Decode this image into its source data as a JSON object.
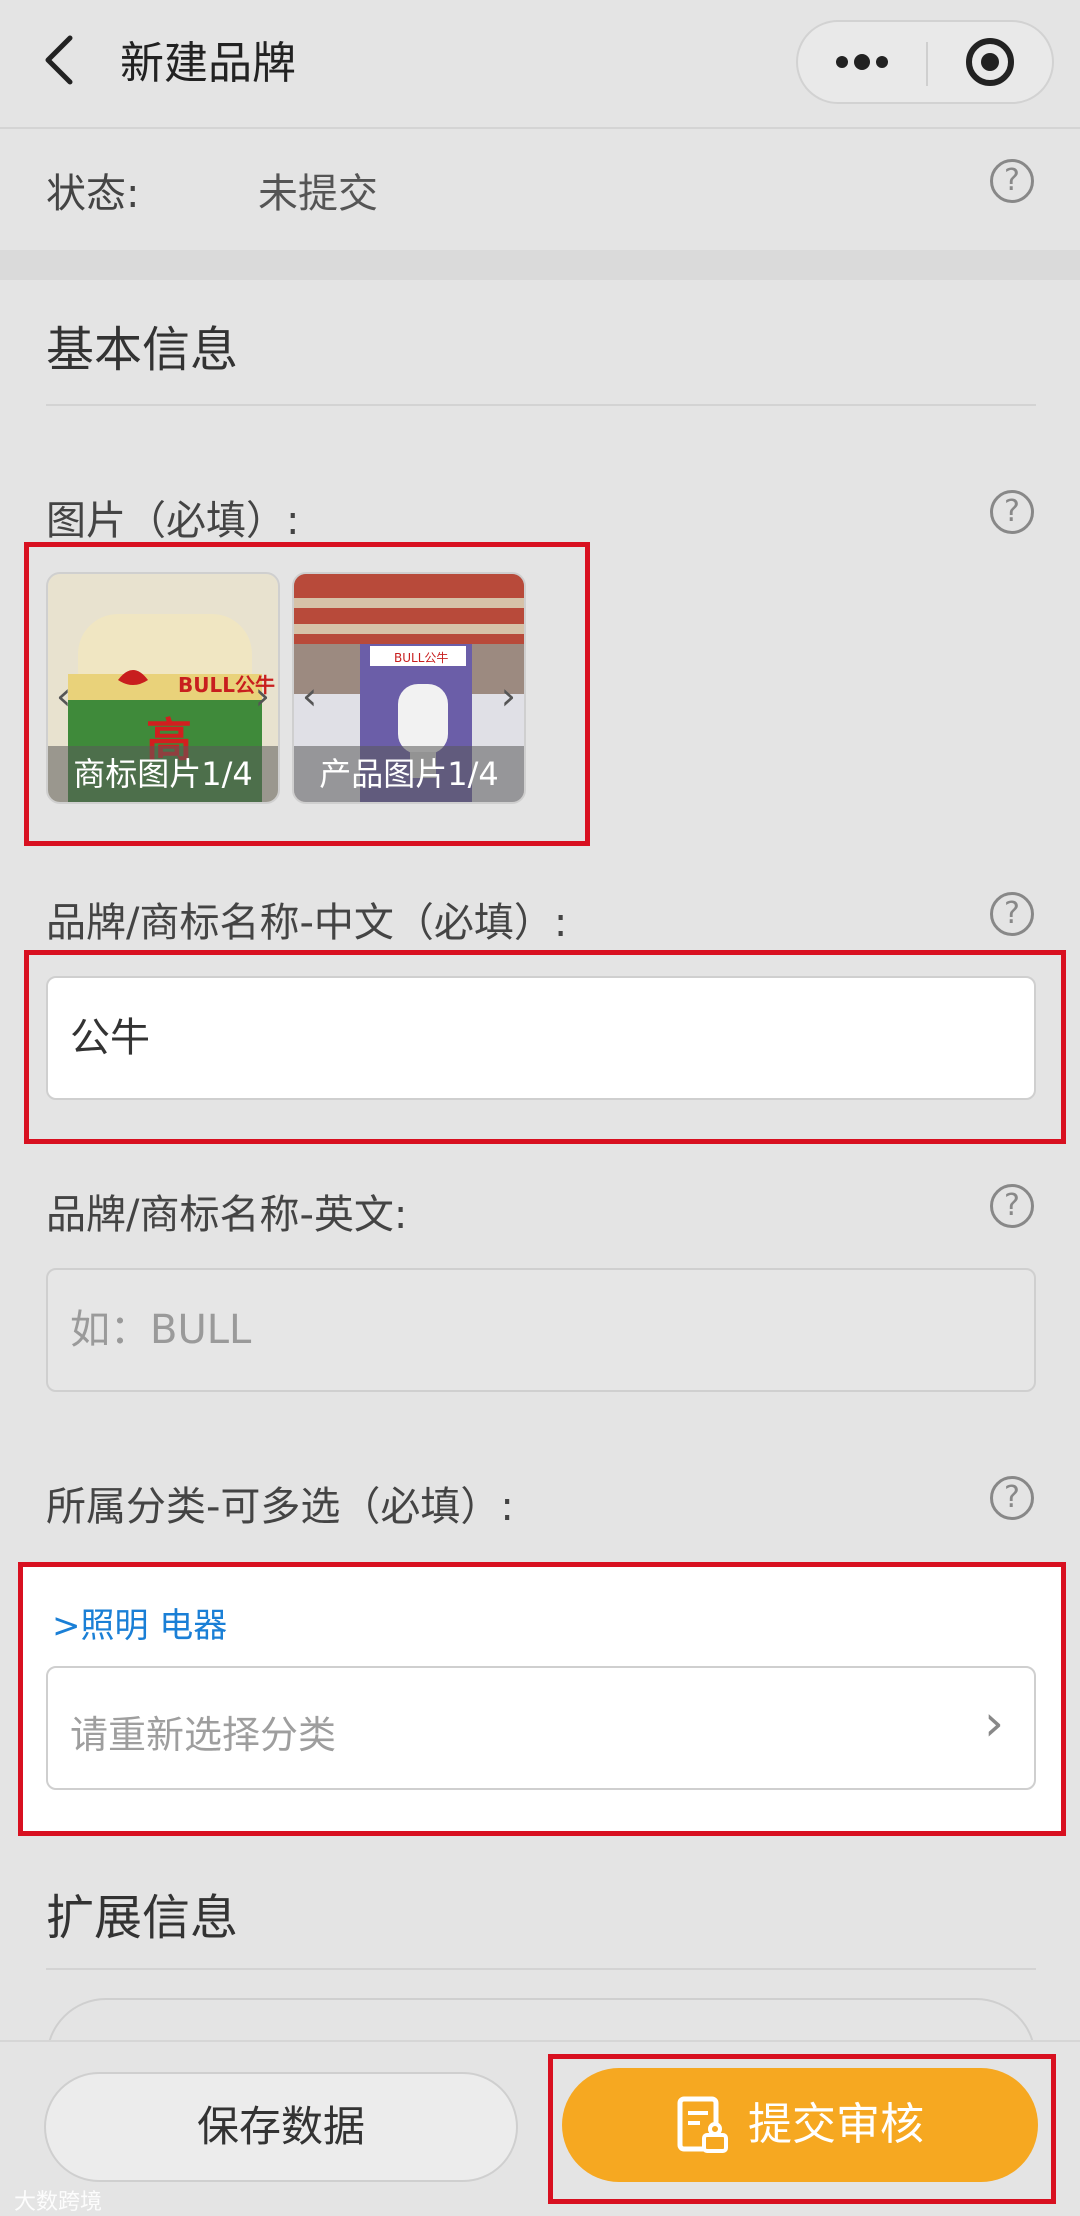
{
  "nav": {
    "title": "新建品牌",
    "more_icon": "more-dots-icon",
    "close_icon": "target-circle-icon"
  },
  "status": {
    "label": "状态:",
    "value": "未提交"
  },
  "basic_info": {
    "title": "基本信息",
    "images": {
      "label": "图片（必填）:",
      "items": [
        {
          "caption": "商标图片1/4",
          "logo_text": "BULL公牛",
          "big_char": "高"
        },
        {
          "caption": "产品图片1/4",
          "logo_text": "BULL公牛"
        }
      ]
    },
    "name_cn": {
      "label": "品牌/商标名称-中文（必填）:",
      "value": "公牛"
    },
    "name_en": {
      "label": "品牌/商标名称-英文:",
      "placeholder": "如：BULL"
    },
    "category": {
      "label": "所属分类-可多选（必填）:",
      "selected_path": "照明 电器",
      "placeholder": "请重新选择分类"
    }
  },
  "extended_info": {
    "title": "扩展信息"
  },
  "actions": {
    "save_label": "保存数据",
    "submit_label": "提交审核"
  },
  "watermark": "大数跨境",
  "colors": {
    "accent": "#f6a821",
    "highlight_box": "#d81020",
    "link": "#1a7fd6"
  }
}
